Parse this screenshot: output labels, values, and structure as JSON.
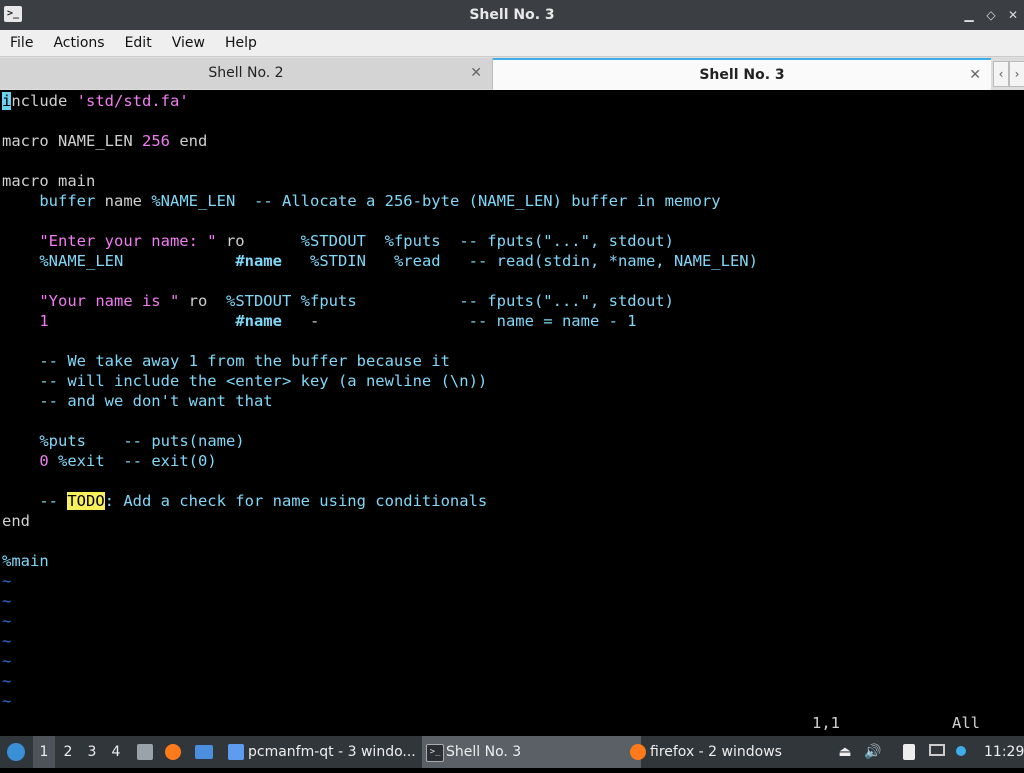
{
  "window": {
    "title": "Shell No. 3",
    "app_icon": "terminal-icon",
    "buttons": {
      "minimize": "▁",
      "maximize": "◇",
      "close": "✕"
    }
  },
  "menu": [
    "File",
    "Actions",
    "Edit",
    "View",
    "Help"
  ],
  "tabs": [
    {
      "label": "Shell No. 2",
      "active": false
    },
    {
      "label": "Shell No. 3",
      "active": true
    }
  ],
  "tab_nav": {
    "left": "‹",
    "right": "›"
  },
  "editor": {
    "lines": [
      "include 'std/std.fa'",
      "",
      "macro NAME_LEN 256 end",
      "",
      "macro main",
      "    buffer name %NAME_LEN  -- Allocate a 256-byte (NAME_LEN) buffer in memory",
      "",
      "    \"Enter your name: \" ro      %STDOUT  %fputs  -- fputs(\"...\", stdout)",
      "    %NAME_LEN            #name   %STDIN   %read   -- read(stdin, *name, NAME_LEN)",
      "",
      "    \"Your name is \" ro  %STDOUT %fputs           -- fputs(\"...\", stdout)",
      "    1                    #name   -                -- name = name - 1",
      "",
      "    -- We take away 1 from the buffer because it",
      "    -- will include the <enter> key (a newline (\\n))",
      "    -- and we don't want that",
      "",
      "    %puts    -- puts(name)",
      "    0 %exit  -- exit(0)",
      "",
      "    -- TODO: Add a check for name using conditionals",
      "end",
      "",
      "%main",
      "~",
      "~",
      "~",
      "~",
      "~",
      "~",
      "~"
    ],
    "cursor_position": "1,1",
    "scroll_indicator": "All"
  },
  "taskbar": {
    "start_icon": "distro-logo-icon",
    "workspaces": [
      "1",
      "2",
      "3",
      "4"
    ],
    "active_workspace": "1",
    "launchers": [
      "file-manager-icon",
      "firefox-icon",
      "desktop-icon"
    ],
    "tasks": [
      {
        "label": "pcmanfm-qt - 3 windo...",
        "icon": "folder-icon",
        "active": false
      },
      {
        "label": "Shell No. 3",
        "icon": "terminal-icon",
        "active": true
      },
      {
        "label": "firefox - 2 windows",
        "icon": "firefox-icon",
        "active": false
      }
    ],
    "tray": [
      "eject-icon",
      "volume-icon",
      "clipboard-icon",
      "network-icon"
    ],
    "clock": "11:29"
  },
  "colors": {
    "accent": "#3daee9",
    "string": "#f27cf2",
    "keyword": "#7fd8f8",
    "todo_bg": "#f7f05b",
    "taskbar": "#31363b"
  }
}
